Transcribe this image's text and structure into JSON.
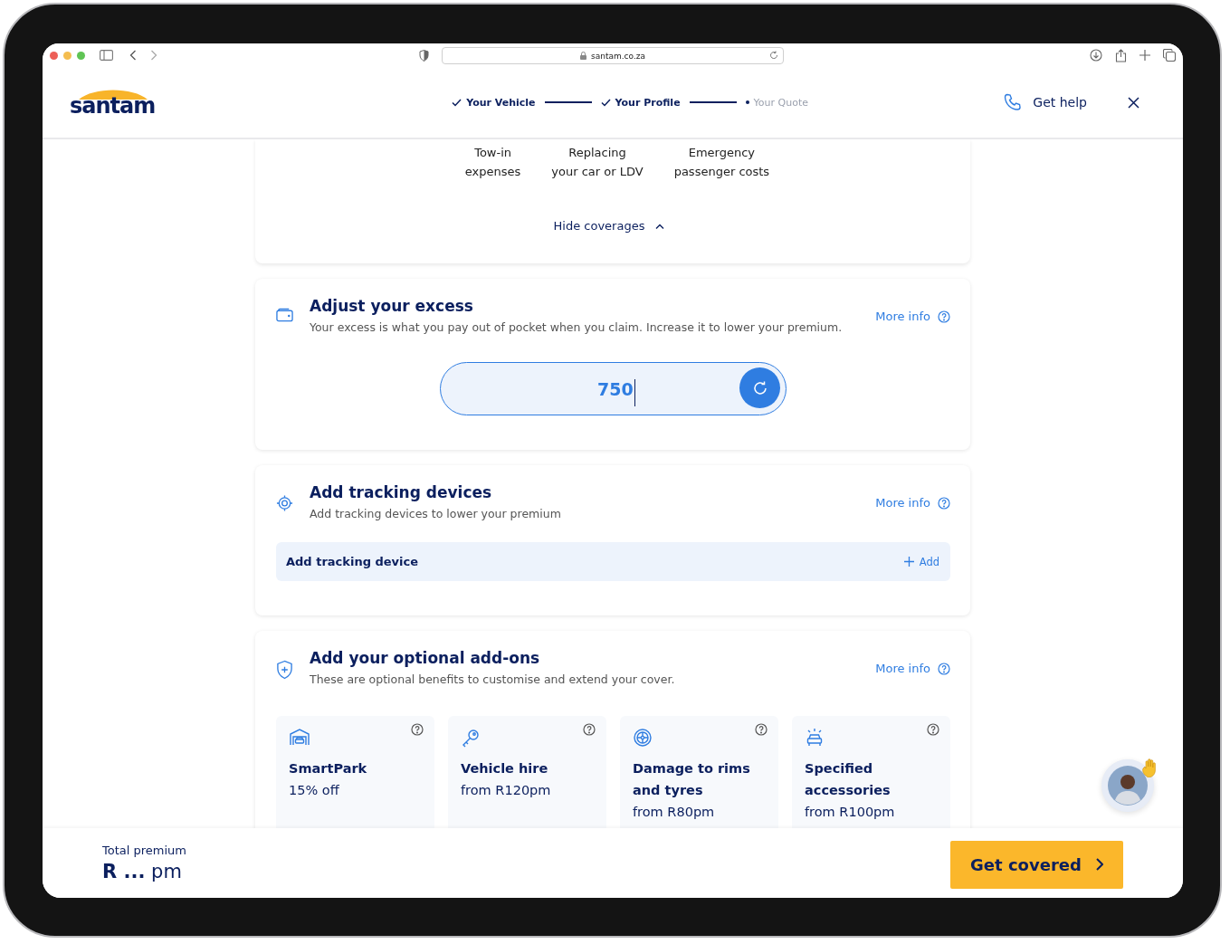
{
  "browser": {
    "url": "santam.co.za"
  },
  "header": {
    "logo": "santam",
    "steps": [
      {
        "label": "Your Vehicle",
        "done": true
      },
      {
        "label": "Your Profile",
        "done": true
      },
      {
        "label": "Your Quote",
        "done": false
      }
    ],
    "help": "Get help"
  },
  "coverages": {
    "items": [
      "Tow-in\nexpenses",
      "Replacing\nyour car or LDV",
      "Emergency\npassenger costs"
    ],
    "toggle": "Hide coverages"
  },
  "sections": [
    {
      "kind": "excess",
      "title": "Adjust your excess",
      "description": "Your excess is what you pay out of pocket when you claim. Increase it to lower your premium.",
      "more_info": "More info",
      "value": "750"
    },
    {
      "kind": "tracking",
      "title": "Add tracking devices",
      "description": "Add tracking devices to lower your premium",
      "more_info": "More info",
      "row_label": "Add tracking device",
      "action": "Add"
    },
    {
      "kind": "addons",
      "title": "Add your optional add-ons",
      "description": "These are optional benefits to customise and extend your cover.",
      "more_info": "More info",
      "items": [
        {
          "kind": "parking",
          "title": "SmartPark",
          "price": "15% off"
        },
        {
          "kind": "hire",
          "title": "Vehicle hire",
          "price": "from R120pm"
        },
        {
          "kind": "rims",
          "title": "Damage to rims and tyres",
          "price": "from R80pm"
        },
        {
          "kind": "accessories",
          "title": "Specified accessories",
          "price": "from R100pm"
        }
      ]
    }
  ],
  "footer": {
    "label": "Total premium",
    "amount": "**R ...** pm",
    "button": "Get covered"
  }
}
